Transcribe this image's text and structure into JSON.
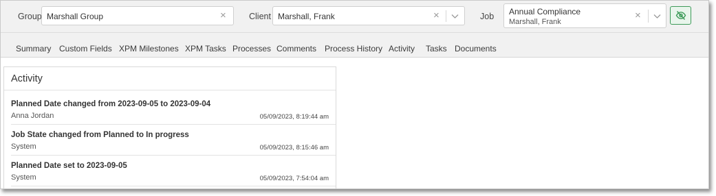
{
  "filters": {
    "group": {
      "label": "Group",
      "value": "Marshall Group"
    },
    "client": {
      "label": "Client",
      "value": "Marshall, Frank"
    },
    "job": {
      "label": "Job",
      "value": "Annual Compliance",
      "sub_value": "Marshall, Frank"
    },
    "toggle_icon": "eye-slash-icon"
  },
  "tabs": [
    {
      "label": "Summary"
    },
    {
      "label": "Custom Fields"
    },
    {
      "label": "XPM Milestones"
    },
    {
      "label": "XPM Tasks"
    },
    {
      "label": "Processes"
    },
    {
      "label": "Comments"
    },
    {
      "label": "Process History"
    },
    {
      "label": "Activity",
      "active": true
    },
    {
      "label": "Tasks"
    },
    {
      "label": "Documents"
    }
  ],
  "activity": {
    "title": "Activity",
    "entries": [
      {
        "text": "Planned Date changed from 2023-09-05 to 2023-09-04",
        "user": "Anna Jordan",
        "datetime": "05/09/2023, 8:19:44 am"
      },
      {
        "text": "Job State changed from Planned to In progress",
        "user": "System",
        "datetime": "05/09/2023, 8:15:46 am"
      },
      {
        "text": "Planned Date set to 2023-09-05",
        "user": "System",
        "datetime": "05/09/2023, 7:54:04 am"
      }
    ]
  },
  "colors": {
    "accent": "#3c9a58",
    "toolbar_bg": "#f1f1f1"
  }
}
